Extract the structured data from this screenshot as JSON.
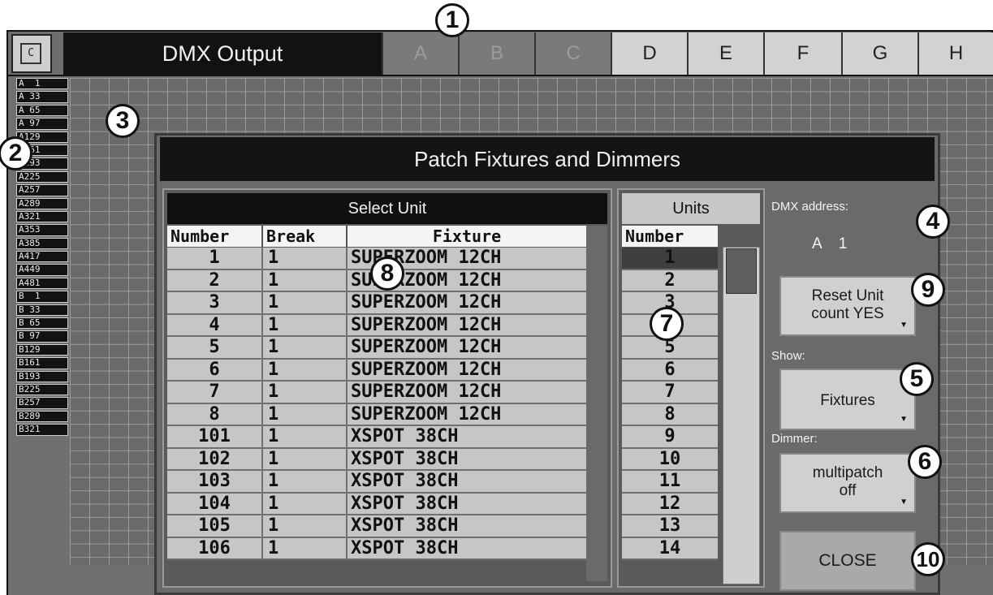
{
  "window": {
    "corner_button": "C",
    "title": "DMX Output",
    "pages": [
      {
        "label": "A",
        "state": "dim"
      },
      {
        "label": "B",
        "state": "dim"
      },
      {
        "label": "C",
        "state": "dim"
      },
      {
        "label": "D",
        "state": "lit"
      },
      {
        "label": "E",
        "state": "lit"
      },
      {
        "label": "F",
        "state": "lit"
      },
      {
        "label": "G",
        "state": "lit"
      },
      {
        "label": "H",
        "state": "lit"
      }
    ]
  },
  "row_labels": [
    "A  1",
    "A 33",
    "A 65",
    "A 97",
    "A129",
    "A161",
    "A193",
    "A225",
    "A257",
    "A289",
    "A321",
    "A353",
    "A385",
    "A417",
    "A449",
    "A481",
    "B  1",
    "B 33",
    "B 65",
    "B 97",
    "B129",
    "B161",
    "B193",
    "B225",
    "B257",
    "B289",
    "B321"
  ],
  "dialog": {
    "title": "Patch Fixtures and Dimmers",
    "select_unit": {
      "heading": "Select Unit",
      "columns": [
        "Number",
        "Break",
        "Fixture"
      ],
      "rows": [
        {
          "number": "1",
          "break": "1",
          "fixture": "SUPERZOOM 12CH"
        },
        {
          "number": "2",
          "break": "1",
          "fixture": "SUPERZOOM 12CH"
        },
        {
          "number": "3",
          "break": "1",
          "fixture": "SUPERZOOM 12CH"
        },
        {
          "number": "4",
          "break": "1",
          "fixture": "SUPERZOOM 12CH"
        },
        {
          "number": "5",
          "break": "1",
          "fixture": "SUPERZOOM 12CH"
        },
        {
          "number": "6",
          "break": "1",
          "fixture": "SUPERZOOM 12CH"
        },
        {
          "number": "7",
          "break": "1",
          "fixture": "SUPERZOOM 12CH"
        },
        {
          "number": "8",
          "break": "1",
          "fixture": "SUPERZOOM 12CH"
        },
        {
          "number": "101",
          "break": "1",
          "fixture": "XSPOT 38CH"
        },
        {
          "number": "102",
          "break": "1",
          "fixture": "XSPOT 38CH"
        },
        {
          "number": "103",
          "break": "1",
          "fixture": "XSPOT 38CH"
        },
        {
          "number": "104",
          "break": "1",
          "fixture": "XSPOT 38CH"
        },
        {
          "number": "105",
          "break": "1",
          "fixture": "XSPOT 38CH"
        },
        {
          "number": "106",
          "break": "1",
          "fixture": "XSPOT 38CH"
        }
      ]
    },
    "units": {
      "heading": "Units",
      "column": "Number",
      "values": [
        "1",
        "2",
        "3",
        "4",
        "5",
        "6",
        "7",
        "8",
        "9",
        "10",
        "11",
        "12",
        "13",
        "14"
      ],
      "selected": "1"
    },
    "dmx_address_label": "DMX address:",
    "dmx_address_value": "A    1",
    "reset_unit": {
      "line1": "Reset Unit",
      "line2": "count YES"
    },
    "show_label": "Show:",
    "show_button": "Fixtures",
    "dimmer_label": "Dimmer:",
    "dimmer_button": {
      "line1": "multipatch",
      "line2": "off"
    },
    "close_button": "CLOSE"
  },
  "callouts": [
    "1",
    "2",
    "3",
    "4",
    "5",
    "6",
    "7",
    "8",
    "9",
    "10"
  ],
  "icons": {
    "dropdown": "dropdown-arrow-icon"
  }
}
